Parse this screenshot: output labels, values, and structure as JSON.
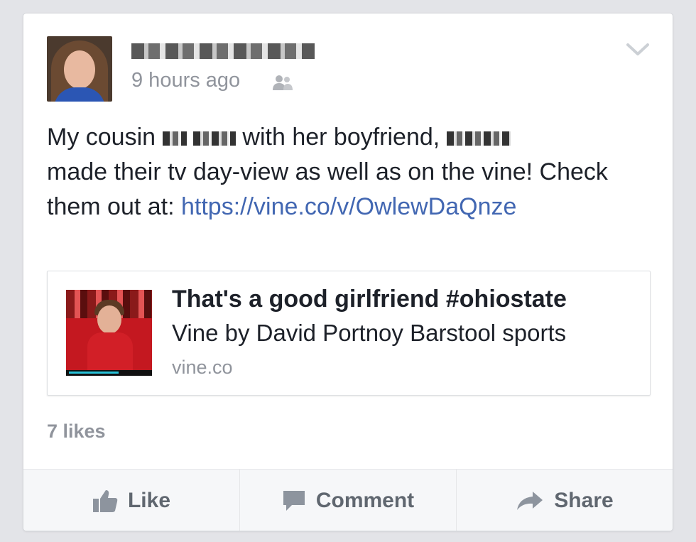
{
  "post": {
    "timestamp": "9 hours ago",
    "text_part1": "My cousin",
    "text_part2": "with her boyfriend,",
    "text_part3": "made their tv day-view as well as on the vine! Check them out at: ",
    "link": "https://vine.co/v/OwlewDaQnze"
  },
  "link_card": {
    "title": "That's a good girlfriend #ohiostate",
    "description": "Vine by David Portnoy Barstool sports",
    "domain": "vine.co"
  },
  "likes": "7 likes",
  "actions": {
    "like": "Like",
    "comment": "Comment",
    "share": "Share"
  },
  "icons": {
    "audience": "friends-icon",
    "menu": "chevron-down-icon",
    "like": "thumbs-up-icon",
    "comment": "speech-bubble-icon",
    "share": "share-arrow-icon"
  },
  "colors": {
    "link": "#4267b2",
    "meta": "#90949c",
    "text": "#1d2129",
    "action": "#606770"
  }
}
